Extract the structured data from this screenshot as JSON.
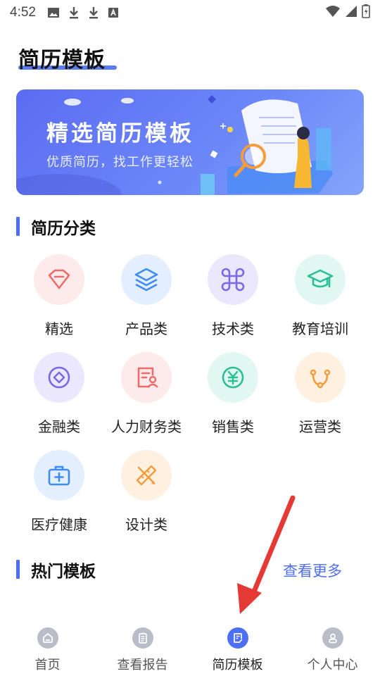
{
  "status_bar": {
    "time": "4:52",
    "left_icons": [
      "image-icon",
      "download-icon",
      "download-icon",
      "font-icon"
    ],
    "right_icons": [
      "wifi-icon",
      "signal-icon",
      "battery-icon"
    ]
  },
  "header": {
    "title": "简历模板"
  },
  "banner": {
    "title": "精选简历模板",
    "subtitle": "优质简历，找工作更轻松"
  },
  "categories_section": {
    "title": "简历分类"
  },
  "categories": [
    {
      "label": "精选",
      "icon": "diamond-icon",
      "bg": "#fdebeb",
      "color": "#ee6b6b"
    },
    {
      "label": "产品类",
      "icon": "layers-icon",
      "bg": "#e3efff",
      "color": "#3d8bf5"
    },
    {
      "label": "技术类",
      "icon": "command-icon",
      "bg": "#ebe7fd",
      "color": "#7a68e8"
    },
    {
      "label": "教育培训",
      "icon": "graduation-cap-icon",
      "bg": "#e1f7f1",
      "color": "#2bbf96"
    },
    {
      "label": "金融类",
      "icon": "coin-icon",
      "bg": "#ebe7fd",
      "color": "#7a68e8"
    },
    {
      "label": "人力财务类",
      "icon": "person-document-icon",
      "bg": "#fdebeb",
      "color": "#ee6b6b"
    },
    {
      "label": "销售类",
      "icon": "yuan-icon",
      "bg": "#e1f7f1",
      "color": "#2bbf96"
    },
    {
      "label": "运营类",
      "icon": "stethoscope-icon",
      "bg": "#fff0e0",
      "color": "#f59b3c"
    },
    {
      "label": "医疗健康",
      "icon": "medical-kit-icon",
      "bg": "#e3efff",
      "color": "#3d8bf5"
    },
    {
      "label": "设计类",
      "icon": "ruler-pencil-icon",
      "bg": "#fff0e0",
      "color": "#f59b3c"
    }
  ],
  "hot_section": {
    "title": "热门模板",
    "more_label": "查看更多"
  },
  "tabbar": {
    "items": [
      {
        "label": "首页",
        "icon": "home-icon",
        "active": false
      },
      {
        "label": "查看报告",
        "icon": "report-icon",
        "active": false
      },
      {
        "label": "简历模板",
        "icon": "resume-template-icon",
        "active": true
      },
      {
        "label": "个人中心",
        "icon": "user-icon",
        "active": false
      }
    ]
  },
  "colors": {
    "accent": "#4d6ef5",
    "annotation_arrow": "#e53935"
  }
}
